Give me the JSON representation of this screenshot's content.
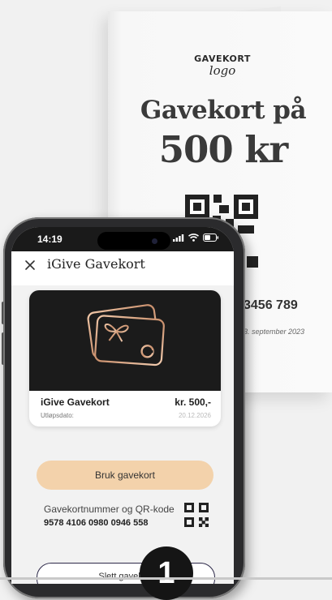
{
  "printed_card": {
    "logo_line1": "GAVEKORT",
    "logo_line2": "logo",
    "title": "Gavekort på",
    "amount": "500 kr",
    "number_partial": "3456 789",
    "date_partial": "3. september 2023"
  },
  "status_bar": {
    "time": "14:19",
    "icons": [
      "signal-icon",
      "wifi-icon",
      "battery-icon"
    ]
  },
  "app_bar": {
    "close_icon": "close-icon",
    "title": "iGive Gavekort"
  },
  "gift_card": {
    "image_icon": "gift-card-icon",
    "name": "iGive Gavekort",
    "price": "kr. 500,-",
    "expiry_label": "Utløpsdato:",
    "expiry_value": "20.12.2026"
  },
  "actions": {
    "use_label": "Bruk gavekort",
    "delete_label": "Slett gavekort"
  },
  "code": {
    "label": "Gavekortnummer og QR-kode",
    "value": "9578 4106 0980 0946 558",
    "qr_icon": "qr-code-icon"
  },
  "step": {
    "number": "1"
  },
  "colors": {
    "accent": "#f3d2ab",
    "outline": "#2e2a4a",
    "card_dark": "#1b1b1b",
    "rose_gold": "#d9a98a"
  }
}
